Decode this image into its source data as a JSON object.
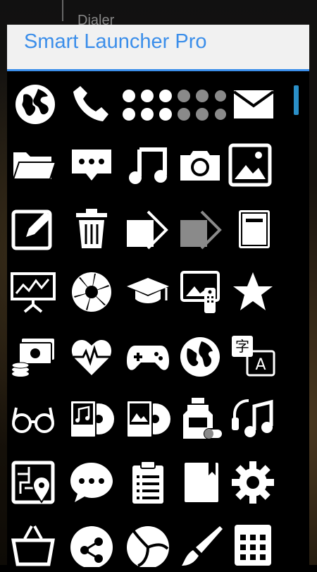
{
  "background": {
    "label": "Dialer"
  },
  "dialog": {
    "title": "Smart Launcher Pro"
  },
  "colors": {
    "accent": "#3b8eea",
    "scrollbar": "#2a8fc8",
    "icon": "#ffffff",
    "icon_dim": "#8a8a8a"
  },
  "icons": [
    "globe-icon",
    "phone-icon",
    "apps-grid-icon",
    "mail-icon",
    "folder-icon",
    "chat-bubble-icon",
    "music-note-icon",
    "camera-icon",
    "image-icon",
    "edit-icon",
    "trash-icon",
    "share-arrow-icon",
    "share-arrow-dim-icon",
    "book-icon",
    "presentation-icon",
    "camera-aperture-icon",
    "graduation-cap-icon",
    "tv-remote-icon",
    "star-icon",
    "money-icon",
    "heart-rate-icon",
    "gamepad-icon",
    "world-map-icon",
    "translate-icon",
    "glasses-icon",
    "music-player-icon",
    "gallery-player-icon",
    "medicine-icon",
    "headphone-music-icon",
    "map-location-icon",
    "message-bubble-icon",
    "clipboard-list-icon",
    "notebook-icon",
    "settings-gear-icon",
    "shopping-basket-icon",
    "share-nodes-icon",
    "volleyball-icon",
    "brush-icon",
    "calculator-icon"
  ]
}
